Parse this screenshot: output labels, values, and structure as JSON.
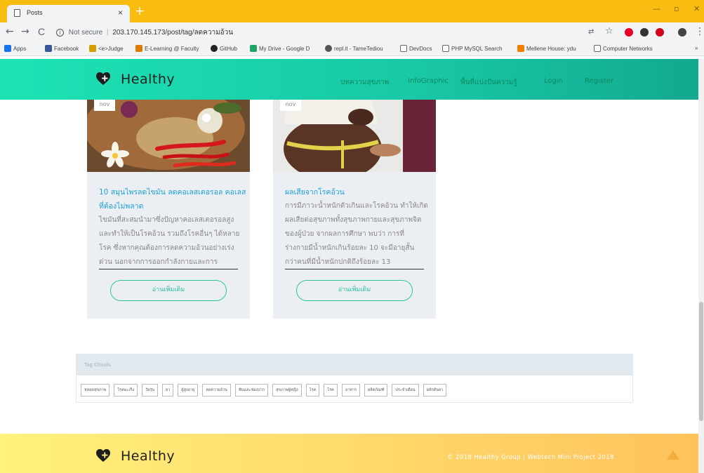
{
  "browser": {
    "tab_title": "Posts",
    "tab_close": "×",
    "new_tab": "+",
    "window_controls": [
      "—",
      "▫",
      "✕"
    ],
    "security_label": "Not secure",
    "url": "203.170.145.173/post/tag/ลดความอ้วน",
    "nav_icons": [
      "←",
      "→",
      "C"
    ],
    "bookmarks": [
      {
        "label": "Apps",
        "icon": "apps-grid-icon",
        "color": "#1a73e8"
      },
      {
        "label": "Facebook",
        "icon": "facebook-icon",
        "color": "#3b5998"
      },
      {
        "label": "<e>Judge",
        "icon": "judge-icon",
        "color": "#d4a000"
      },
      {
        "label": "E-Learning @ Faculty",
        "icon": "elearning-icon",
        "color": "#e07b00"
      },
      {
        "label": "GitHub",
        "icon": "github-icon",
        "color": "#222222"
      },
      {
        "label": "My Drive - Google D",
        "icon": "google-drive-icon",
        "color": "#1fa463"
      },
      {
        "label": "repl.it - TameTediou",
        "icon": "replit-icon",
        "color": "#555555"
      },
      {
        "label": "DevDocs",
        "icon": "devdocs-icon",
        "color": "#666666"
      },
      {
        "label": "PHP MySQL Search",
        "icon": "page-icon",
        "color": "#666666"
      },
      {
        "label": "Mellene House: ydu",
        "icon": "blogger-icon",
        "color": "#f57d00"
      },
      {
        "label": "Computer Networks",
        "icon": "page-icon",
        "color": "#666666"
      }
    ],
    "overflow": "»"
  },
  "site": {
    "brand": "Healthy",
    "nav": [
      "บทความสุขภาพ",
      "InfoGraphic",
      "พื้นที่แบ่งปันความรู้",
      "Login",
      "Register"
    ]
  },
  "cards": [
    {
      "date": "nov",
      "title": "10 สมุนไพรลดไขมัน ลดคอเลสเตอรอล คอเลสที่ต้องไม่พลาด",
      "excerpt": [
        "ไขมันที่สะสมนำมาซึ่งปัญหาคอเลสเตอรอลสูง",
        "และทำให้เป็นโรคอ้วน รวมถึงโรคอื่นๆ ได้หลาย",
        "โรค ซึ่งหากคุณต้องการลดความอ้วนอย่างเร่ง",
        "ด่วน นอกจากการออกกำลังกายและการ"
      ],
      "button": "อ่านเพิ่มเติม"
    },
    {
      "date": "nov",
      "title": "ผลเสียจากโรคอ้วน",
      "excerpt": [
        "การมีภาวะน้ำหนักตัวเกินและโรคอ้วน ทำให้เกิด",
        "ผลเสียต่อสุขภาพทั้งสุขภาพกายและสุขภาพจิต",
        "ของผู้ป่วย จากผลการศึกษา พบว่า การที่",
        "ร่างกายมีน้ำหนักเกินร้อยละ 10 จะมีอายุสั้น",
        "กว่าคนที่มีน้ำหนักปกติถึงร้อยละ 13"
      ],
      "button": "อ่านเพิ่มเติม"
    }
  ],
  "tagcloud": {
    "title": "Tag Clouds",
    "tags": [
      "หลอดสุขภาพ",
      "โรคมะเร็ง",
      "วัยรุ่น",
      "ยา",
      "ผู้สูงอายุ",
      "ลดความอ้วน",
      "ฟันและช่องปาก",
      "สุขภาพผู้หญิง",
      "โรค",
      "โรค",
      "อาหาร",
      "ผลิตภัณฑ์",
      "ประจำเดือน",
      "ผลักดันยา"
    ]
  },
  "footer": {
    "brand": "Healthy",
    "copyright": "© 2018 Healthy Group | Webtech Mini Project 2018"
  }
}
